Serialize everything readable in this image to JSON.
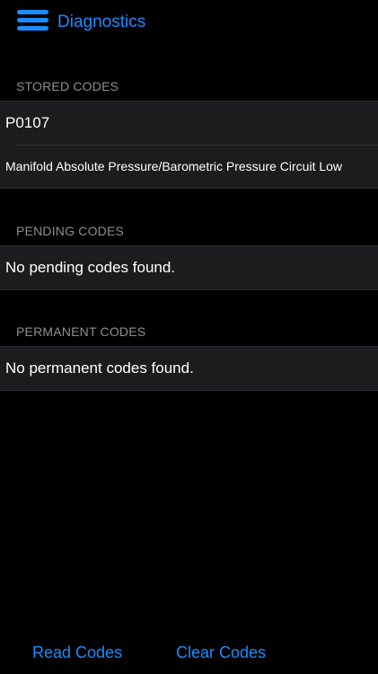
{
  "nav": {
    "title": "Diagnostics"
  },
  "stored": {
    "header": "STORED CODES",
    "code": "P0107",
    "description": "Manifold Absolute Pressure/Barometric Pressure Circuit Low"
  },
  "pending": {
    "header": "PENDING CODES",
    "message": "No pending codes found."
  },
  "permanent": {
    "header": "PERMANENT CODES",
    "message": "No permanent codes found."
  },
  "toolbar": {
    "read_label": "Read Codes",
    "clear_label": "Clear Codes"
  },
  "icons": {
    "menu": "hamburger-menu-icon"
  },
  "colors": {
    "accent": "#1a8cff",
    "background": "#000000",
    "cell_background": "#1c1c1e",
    "section_header": "#8e8e93"
  }
}
